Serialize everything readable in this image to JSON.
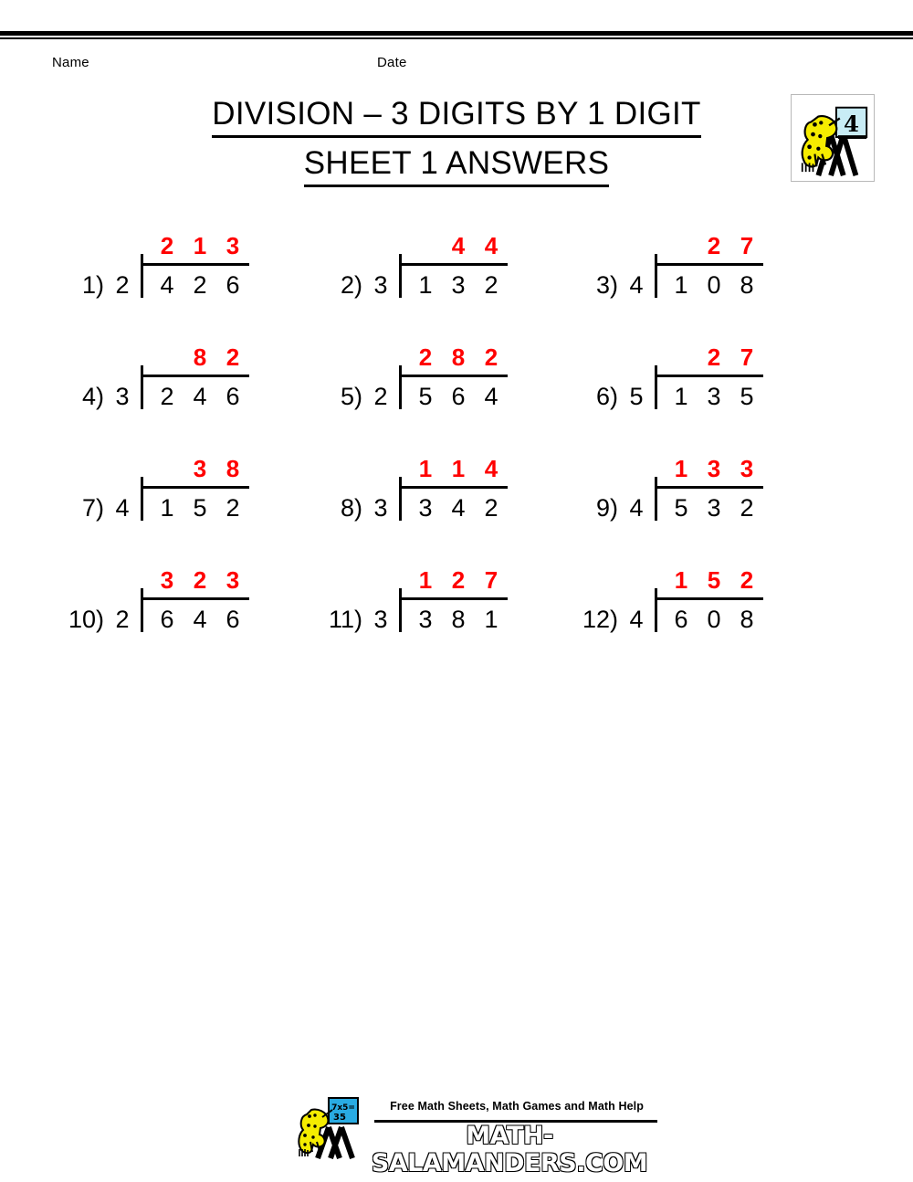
{
  "page": {
    "name_label": "Name",
    "date_label": "Date",
    "title_line1": "DIVISION – 3 DIGITS BY 1 DIGIT",
    "title_line2": "SHEET 1 ANSWERS"
  },
  "header_logo": {
    "icon": "salamander-board-icon",
    "board_text": "4",
    "board_color": "#c8ecf5",
    "body_color": "#f5ec00"
  },
  "colors": {
    "answer_red": "#FF0000",
    "ink_black": "#000000",
    "board_blue": "#29ABE2"
  },
  "problems": [
    {
      "index": "1)",
      "divisor": "2",
      "dividend": [
        "4",
        "2",
        "6"
      ],
      "quotient": [
        "2",
        "1",
        "3"
      ]
    },
    {
      "index": "2)",
      "divisor": "3",
      "dividend": [
        "1",
        "3",
        "2"
      ],
      "quotient": [
        "4",
        "4"
      ]
    },
    {
      "index": "3)",
      "divisor": "4",
      "dividend": [
        "1",
        "0",
        "8"
      ],
      "quotient": [
        "2",
        "7"
      ]
    },
    {
      "index": "4)",
      "divisor": "3",
      "dividend": [
        "2",
        "4",
        "6"
      ],
      "quotient": [
        "8",
        "2"
      ]
    },
    {
      "index": "5)",
      "divisor": "2",
      "dividend": [
        "5",
        "6",
        "4"
      ],
      "quotient": [
        "2",
        "8",
        "2"
      ]
    },
    {
      "index": "6)",
      "divisor": "5",
      "dividend": [
        "1",
        "3",
        "5"
      ],
      "quotient": [
        "2",
        "7"
      ]
    },
    {
      "index": "7)",
      "divisor": "4",
      "dividend": [
        "1",
        "5",
        "2"
      ],
      "quotient": [
        "3",
        "8"
      ]
    },
    {
      "index": "8)",
      "divisor": "3",
      "dividend": [
        "3",
        "4",
        "2"
      ],
      "quotient": [
        "1",
        "1",
        "4"
      ]
    },
    {
      "index": "9)",
      "divisor": "4",
      "dividend": [
        "5",
        "3",
        "2"
      ],
      "quotient": [
        "1",
        "3",
        "3"
      ]
    },
    {
      "index": "10)",
      "divisor": "2",
      "dividend": [
        "6",
        "4",
        "6"
      ],
      "quotient": [
        "3",
        "2",
        "3"
      ]
    },
    {
      "index": "11)",
      "divisor": "3",
      "dividend": [
        "3",
        "8",
        "1"
      ],
      "quotient": [
        "1",
        "2",
        "7"
      ]
    },
    {
      "index": "12)",
      "divisor": "4",
      "dividend": [
        "6",
        "0",
        "8"
      ],
      "quotient": [
        "1",
        "5",
        "2"
      ]
    }
  ],
  "footer": {
    "tagline": "Free Math Sheets, Math Games and Math Help",
    "domain": "MATH-SALAMANDERS.COM",
    "logo_icon": "salamander-board-icon",
    "logo_board_text_line1": "7x5=",
    "logo_board_text_line2": "35"
  }
}
